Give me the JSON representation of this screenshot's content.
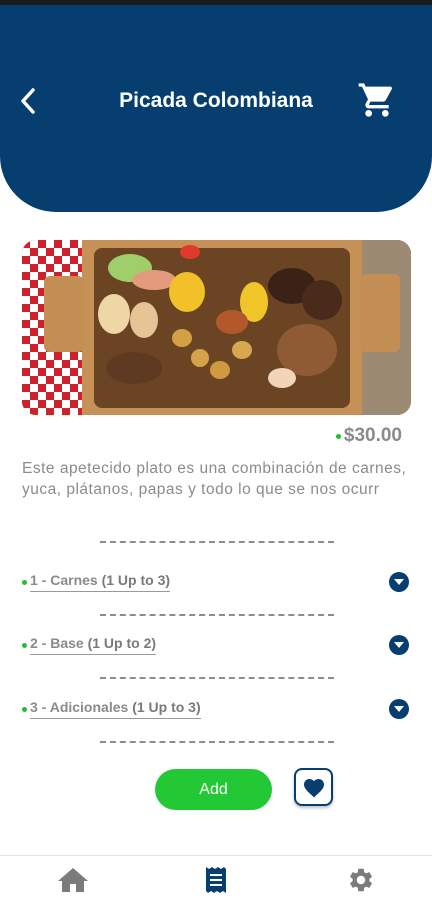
{
  "header": {
    "title": "Picada Colombiana",
    "back_icon": "chevron-left-icon",
    "cart_icon": "cart-icon"
  },
  "product": {
    "image_alt": "picada-platter-image",
    "price": "$30.00",
    "description": "Este apetecido plato es una combinación de carnes, yuca, plátanos, papas y todo lo que se nos ocurr"
  },
  "sections": [
    {
      "label": "1 - Carnes",
      "limit": "(1 Up to 3)"
    },
    {
      "label": "2 - Base",
      "limit": "(1 Up to 2)"
    },
    {
      "label": "3 - Adicionales",
      "limit": "(1 Up to 3)"
    }
  ],
  "actions": {
    "add_label": "Add",
    "favorite_icon": "heart-icon"
  },
  "bottom_nav": {
    "items": [
      {
        "icon": "home-icon"
      },
      {
        "icon": "receipt-icon"
      },
      {
        "icon": "gear-icon"
      }
    ]
  },
  "colors": {
    "brand": "#063e6f",
    "accent_green": "#22c935",
    "text_gray": "#8b8b8b"
  }
}
